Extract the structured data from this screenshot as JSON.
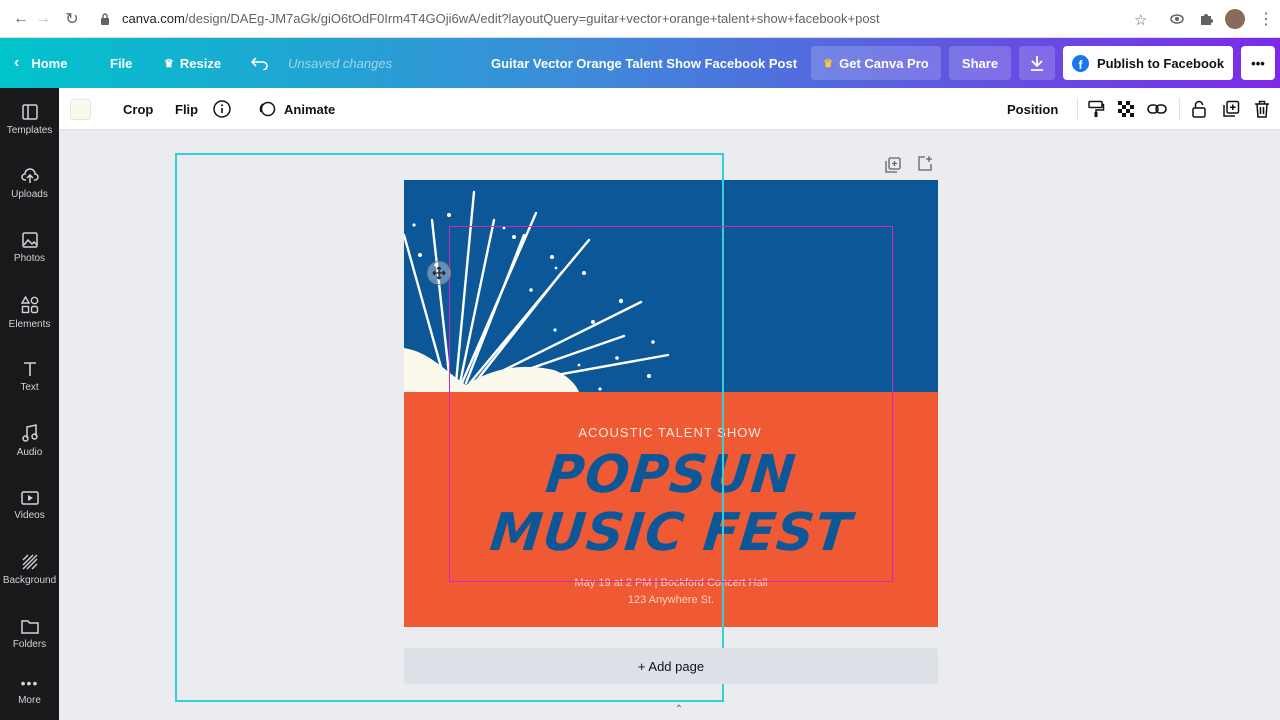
{
  "browser": {
    "url_host": "canva.com",
    "url_path": "/design/DAEg-JM7aGk/giO6tOdF0Irm4T4GOji6wA/edit?layoutQuery=guitar+vector+orange+talent+show+facebook+post"
  },
  "header": {
    "home": "Home",
    "file": "File",
    "resize": "Resize",
    "status": "Unsaved changes",
    "title": "Guitar Vector Orange Talent Show Facebook Post",
    "get_pro": "Get Canva Pro",
    "share": "Share",
    "publish": "Publish to Facebook",
    "more": "•••"
  },
  "sidebar": {
    "items": [
      {
        "label": "Templates",
        "icon": "templates-icon"
      },
      {
        "label": "Uploads",
        "icon": "uploads-icon"
      },
      {
        "label": "Photos",
        "icon": "photos-icon"
      },
      {
        "label": "Elements",
        "icon": "elements-icon"
      },
      {
        "label": "Text",
        "icon": "text-icon"
      },
      {
        "label": "Audio",
        "icon": "audio-icon"
      },
      {
        "label": "Videos",
        "icon": "videos-icon"
      },
      {
        "label": "Background",
        "icon": "background-icon"
      },
      {
        "label": "Folders",
        "icon": "folders-icon"
      },
      {
        "label": "More",
        "icon": "more-icon"
      }
    ]
  },
  "toolbar": {
    "crop": "Crop",
    "flip": "Flip",
    "animate": "Animate",
    "position": "Position"
  },
  "design": {
    "subtitle": "ACOUSTIC TALENT SHOW",
    "title_line1": "POPSUN",
    "title_line2": "MUSIC FEST",
    "details_line1": "May 19 at 2 PM  | Bockford Concert Hall",
    "details_line2": "123 Anywhere St.",
    "colors": {
      "blue": "#0b5797",
      "orange": "#ef5a34",
      "cream": "#fbf8ec"
    }
  },
  "canvas": {
    "add_page": "+ Add page"
  }
}
